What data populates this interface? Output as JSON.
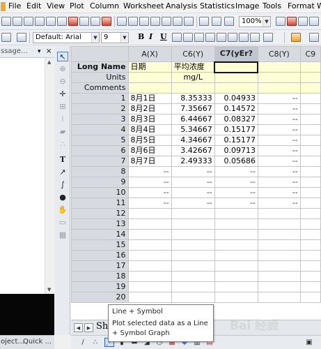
{
  "menu": [
    "File",
    "Edit",
    "View",
    "Plot",
    "Column",
    "Worksheet",
    "Analysis",
    "Statistics",
    "Image",
    "Tools",
    "Format",
    "W"
  ],
  "toolbar": {
    "zoom": "100%",
    "font_style": "Default: Arial",
    "font_size": "9",
    "bold": "B",
    "italic": "I",
    "underline": "U"
  },
  "left_panel": {
    "title": "ssage...",
    "pin": "▾",
    "close": "×",
    "tabs": [
      "oject...",
      "Quick ..."
    ]
  },
  "worksheet": {
    "columns": [
      {
        "label": "A(X)"
      },
      {
        "label": "C6(Y)"
      },
      {
        "label": "C7(yEr?"
      },
      {
        "label": "C8(Y)"
      },
      {
        "label": "C9"
      }
    ],
    "meta_rows": [
      {
        "header": "Long Name",
        "values": [
          "日期",
          "平均浓度",
          "",
          "",
          ""
        ]
      },
      {
        "header": "Units",
        "values": [
          "",
          "mg/L",
          "",
          "",
          ""
        ]
      },
      {
        "header": "Comments",
        "values": [
          "",
          "",
          "",
          "",
          ""
        ]
      }
    ],
    "rows": [
      {
        "n": "1",
        "a": "8月1日",
        "c6": "8.35333",
        "c7": "0.04933",
        "c8": "--",
        "c9": ""
      },
      {
        "n": "2",
        "a": "8月2日",
        "c6": "7.35667",
        "c7": "0.14572",
        "c8": "--",
        "c9": ""
      },
      {
        "n": "3",
        "a": "8月3日",
        "c6": "6.44667",
        "c7": "0.08327",
        "c8": "--",
        "c9": ""
      },
      {
        "n": "4",
        "a": "8月4日",
        "c6": "5.34667",
        "c7": "0.15177",
        "c8": "--",
        "c9": ""
      },
      {
        "n": "5",
        "a": "8月5日",
        "c6": "4.34667",
        "c7": "0.15177",
        "c8": "--",
        "c9": ""
      },
      {
        "n": "6",
        "a": "8月6日",
        "c6": "3.42667",
        "c7": "0.09713",
        "c8": "--",
        "c9": ""
      },
      {
        "n": "7",
        "a": "8月7日",
        "c6": "2.49333",
        "c7": "0.05686",
        "c8": "--",
        "c9": ""
      },
      {
        "n": "8",
        "a": "--",
        "c6": "--",
        "c7": "--",
        "c8": "--",
        "c9": ""
      },
      {
        "n": "9",
        "a": "--",
        "c6": "--",
        "c7": "--",
        "c8": "--",
        "c9": ""
      },
      {
        "n": "10",
        "a": "--",
        "c6": "--",
        "c7": "--",
        "c8": "--",
        "c9": ""
      },
      {
        "n": "11",
        "a": "--",
        "c6": "--",
        "c7": "--",
        "c8": "--",
        "c9": ""
      },
      {
        "n": "12",
        "a": "",
        "c6": "",
        "c7": "",
        "c8": "",
        "c9": ""
      },
      {
        "n": "13",
        "a": "",
        "c6": "",
        "c7": "",
        "c8": "",
        "c9": ""
      },
      {
        "n": "14",
        "a": "",
        "c6": "",
        "c7": "",
        "c8": "",
        "c9": ""
      },
      {
        "n": "15",
        "a": "",
        "c6": "",
        "c7": "",
        "c8": "",
        "c9": ""
      },
      {
        "n": "16",
        "a": "",
        "c6": "",
        "c7": "",
        "c8": "",
        "c9": ""
      },
      {
        "n": "17",
        "a": "",
        "c6": "",
        "c7": "",
        "c8": "",
        "c9": ""
      },
      {
        "n": "18",
        "a": "",
        "c6": "",
        "c7": "",
        "c8": "",
        "c9": ""
      },
      {
        "n": "19",
        "a": "",
        "c6": "",
        "c7": "",
        "c8": "",
        "c9": ""
      },
      {
        "n": "20",
        "a": "",
        "c6": "",
        "c7": "",
        "c8": "",
        "c9": ""
      }
    ]
  },
  "sheet_tab": "Sh",
  "tooltip": {
    "title": "Line + Symbol",
    "description": "Plot selected data as a Line + Symbol Graph"
  },
  "watermark": "Bai 经验",
  "colors": {
    "header_bg": "#d7dbe1",
    "meta_bg": "#ffffd6",
    "accent": "#f2a92e"
  }
}
